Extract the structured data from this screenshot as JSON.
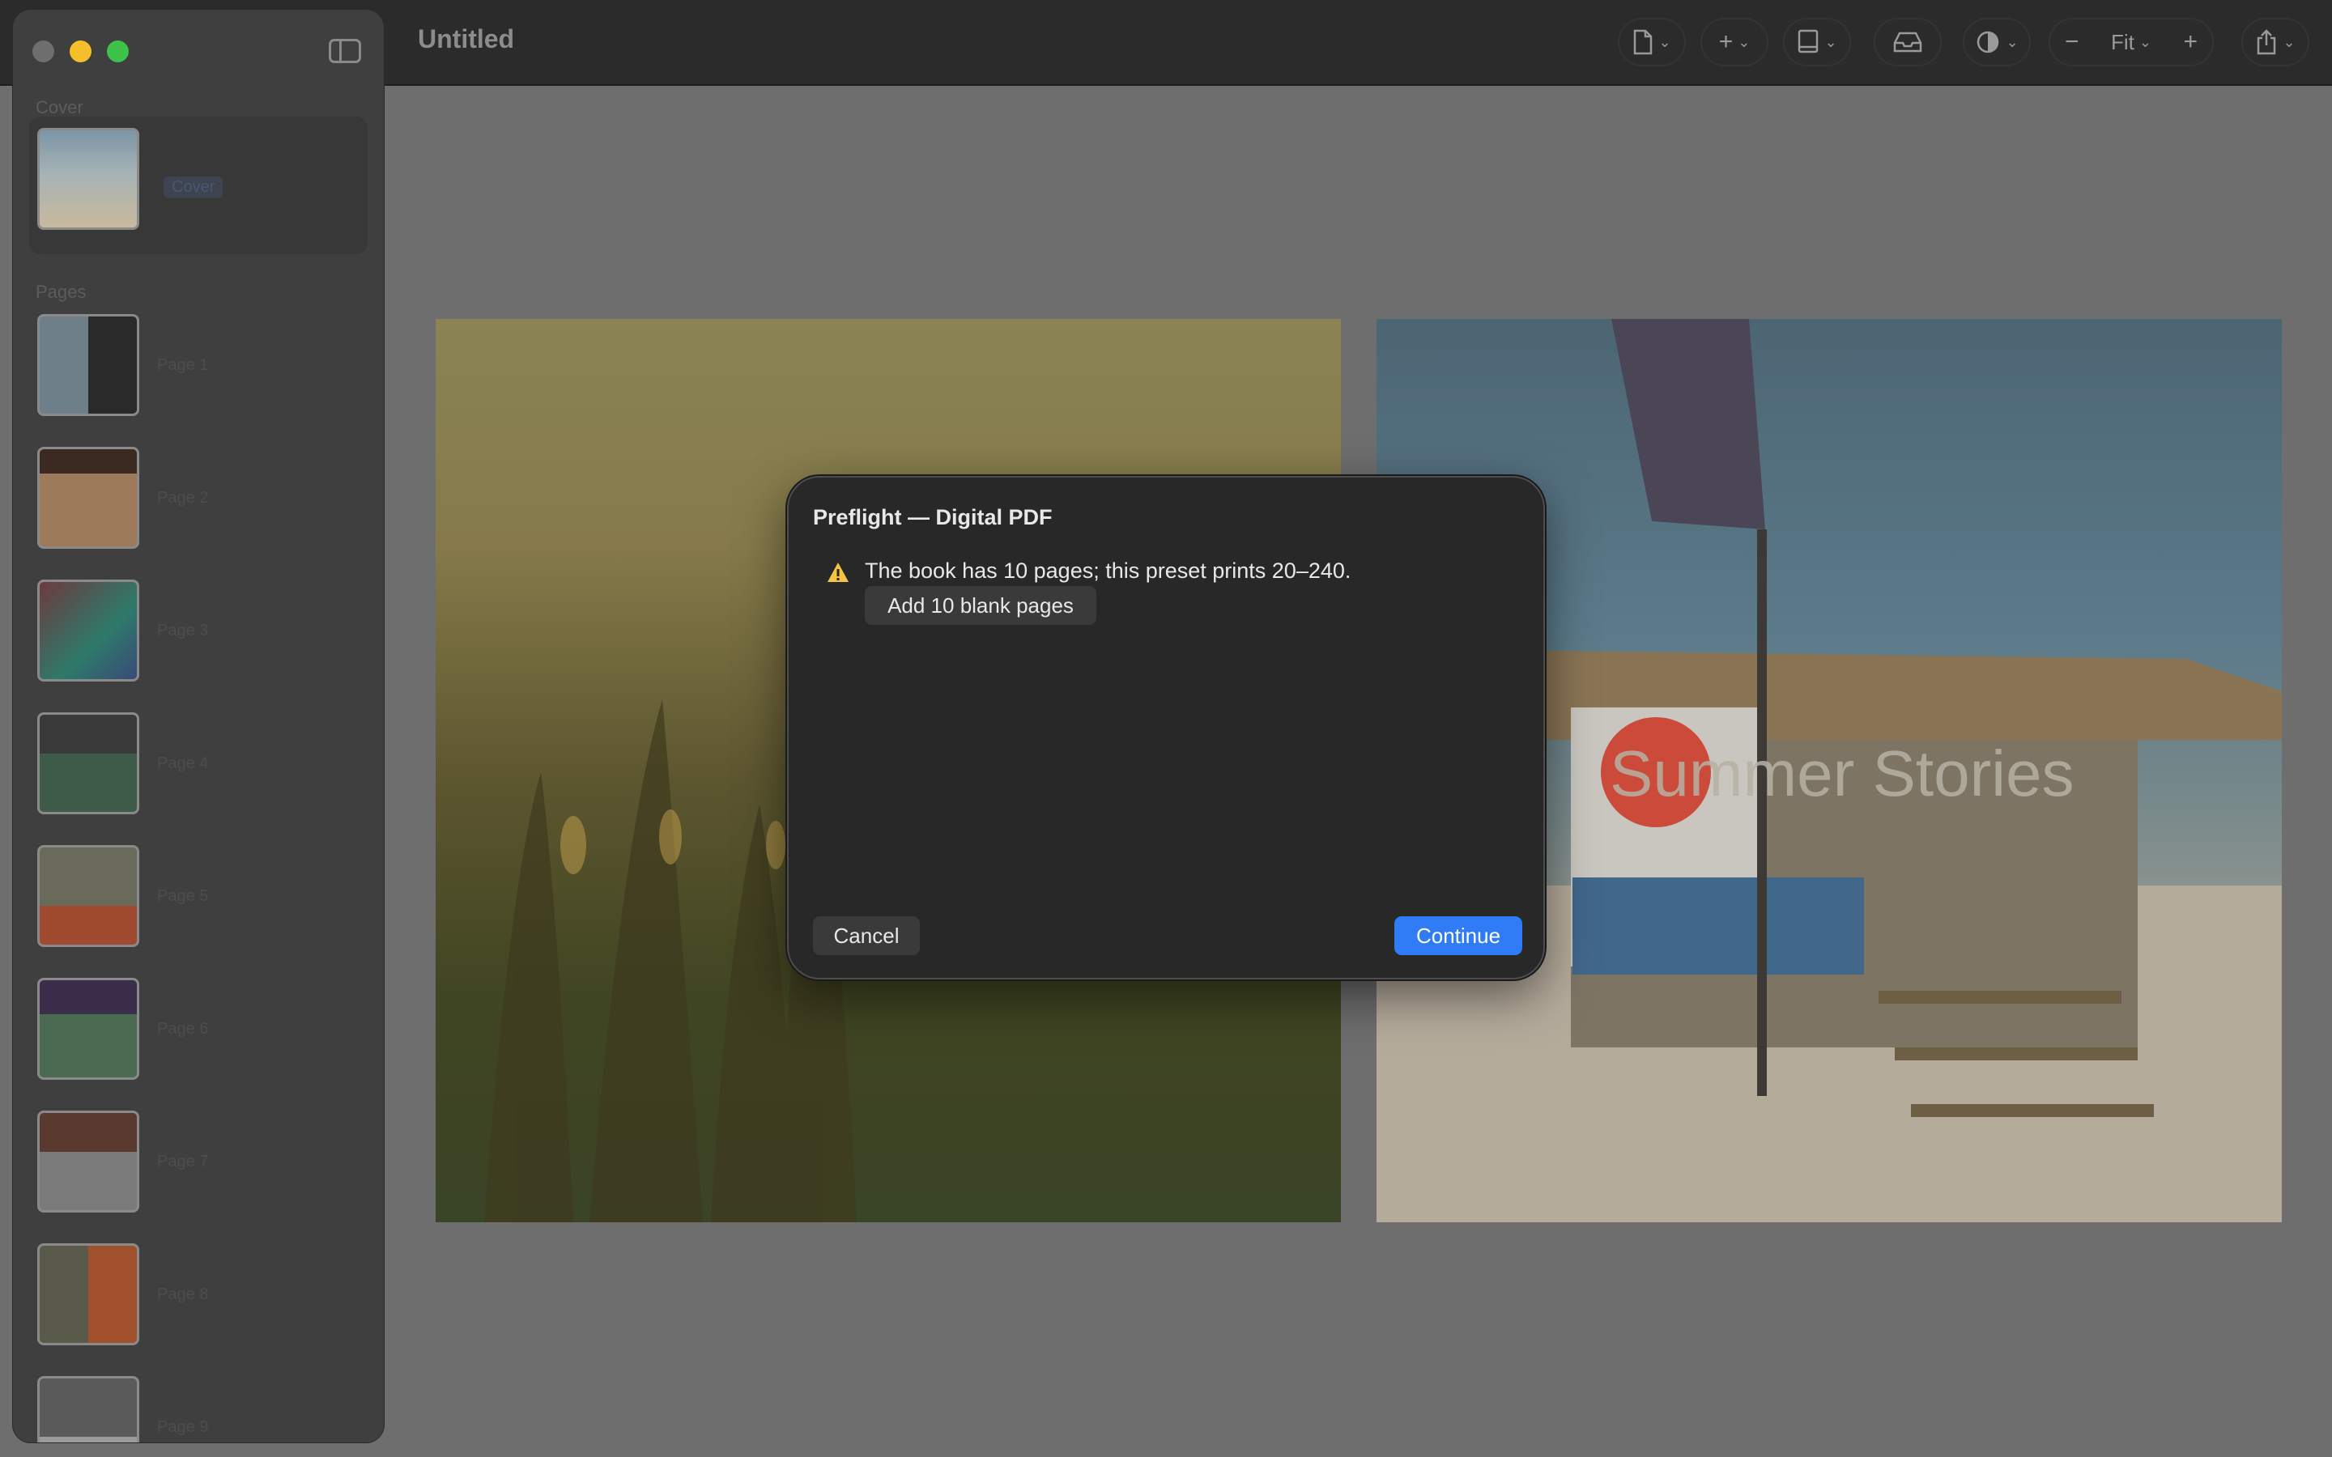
{
  "window": {
    "title": "Untitled"
  },
  "sidebar": {
    "cover_section": "Cover",
    "cover_item": "Cover",
    "pages_section": "Pages",
    "pages": [
      "Page 1",
      "Page 2",
      "Page 3",
      "Page 4",
      "Page 5",
      "Page 6",
      "Page 7",
      "Page 8",
      "Page 9"
    ]
  },
  "toolbar": {
    "icons": [
      "document-menu-icon",
      "add-menu-icon",
      "book-menu-icon",
      "inbox-icon",
      "appearance-menu-icon",
      "zoom-out-icon",
      "zoom-in-icon",
      "share-menu-icon"
    ],
    "zoom_label": "Fit"
  },
  "canvas": {
    "cover_title": "Summer Stories"
  },
  "dialog": {
    "title": "Preflight — Digital PDF",
    "warning": "The book has 10 pages; this preset prints 20–240.",
    "fix_button": "Add 10 blank pages",
    "cancel": "Cancel",
    "continue": "Continue"
  },
  "colors": {
    "accent": "#2f7cf6",
    "warning": "#f5c542"
  }
}
